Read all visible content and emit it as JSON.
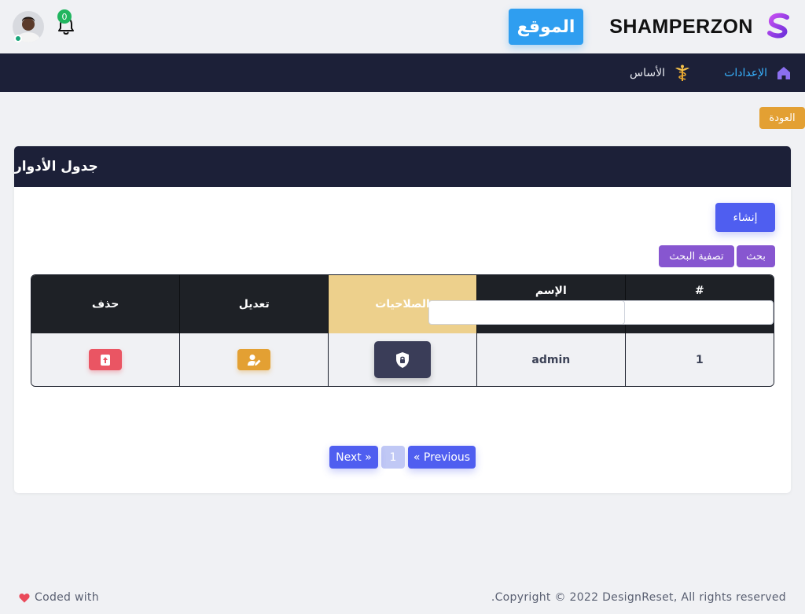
{
  "header": {
    "brand": "SHAMPERZON",
    "site_button": "الموقع",
    "notification_count": "0"
  },
  "nav": {
    "settings_label": "الإعدادات",
    "basics_label": "الأساس"
  },
  "back_label": "العودة",
  "card": {
    "title": "جدول الأدوار",
    "create_label": "إنشاء",
    "search_label": "بحث",
    "filter_label": "تصفية البحث"
  },
  "table": {
    "columns": [
      "#",
      "الإسم",
      "الصلاحيات",
      "تعديل",
      "حذف"
    ],
    "rows": [
      {
        "id": "1",
        "name": "admin"
      }
    ]
  },
  "pagination": {
    "previous": "« Previous",
    "current": "1",
    "next": "Next »"
  },
  "footer": {
    "copyright": "Copyright © 2022 DesignReset, All rights reserved.",
    "coded": "Coded with"
  },
  "colors": {
    "navy": "#1c2038",
    "accent_blue": "#4f5ef0",
    "site_button_blue": "#2f9ef0",
    "purple": "#8756d0",
    "orange": "#e3a033",
    "red": "#ea5563",
    "gold_header": "#edd08c",
    "link_cyan": "#39b3ff"
  },
  "icons": [
    "s-logo-icon",
    "avatar",
    "bell-icon",
    "home-icon",
    "caduceus-icon",
    "shield-lock-icon",
    "user-edit-icon",
    "trash-icon",
    "heart-icon"
  ]
}
